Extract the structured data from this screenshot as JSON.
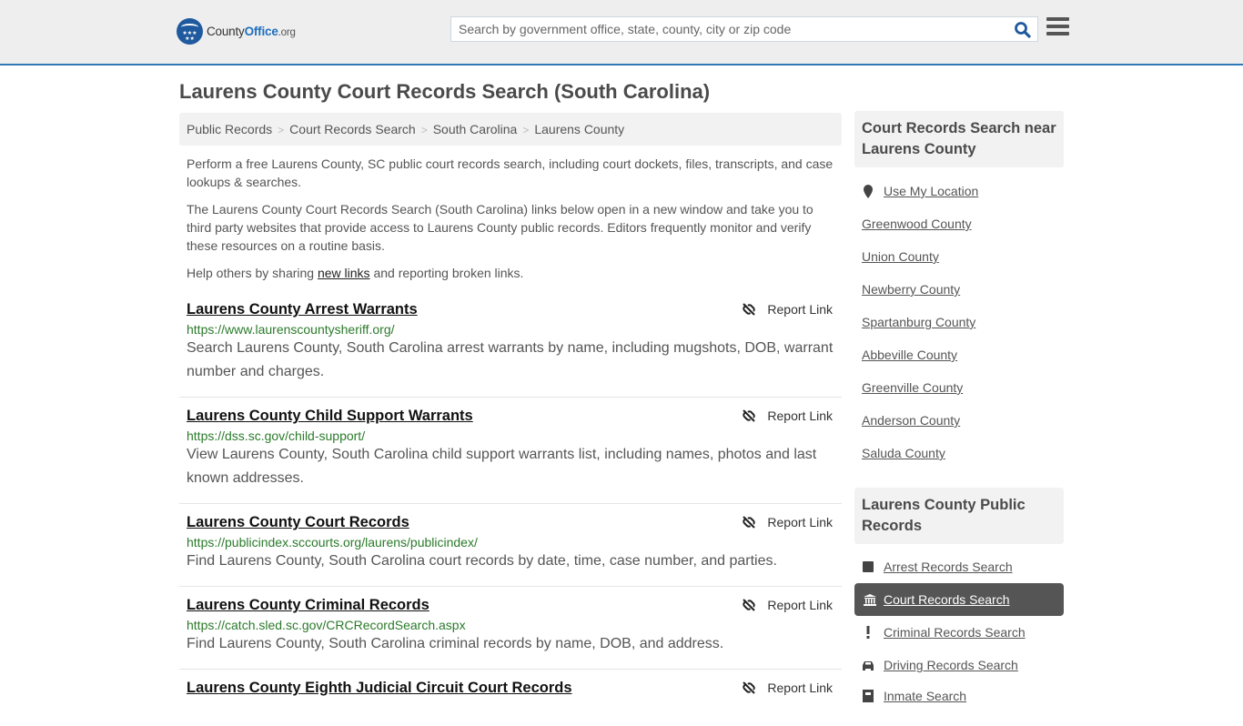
{
  "header": {
    "logo": {
      "name": "County",
      "accent": "Office",
      "tld": ".org"
    },
    "search": {
      "placeholder": "Search by government office, state, county, city or zip code",
      "value": ""
    }
  },
  "page_title": "Laurens County Court Records Search (South Carolina)",
  "breadcrumb": [
    "Public Records",
    "Court Records Search",
    "South Carolina",
    "Laurens County"
  ],
  "intro": {
    "p1": "Perform a free Laurens County, SC public court records search, including court dockets, files, transcripts, and case lookups & searches.",
    "p2": "The Laurens County Court Records Search (South Carolina) links below open in a new window and take you to third party websites that provide access to Laurens County public records. Editors frequently monitor and verify these resources on a routine basis.",
    "p3_before": "Help others by sharing ",
    "p3_link": "new links",
    "p3_after": " and reporting broken links."
  },
  "report_label": "Report Link",
  "listings": [
    {
      "title": "Laurens County Arrest Warrants",
      "url": "https://www.laurenscountysheriff.org/",
      "desc": "Search Laurens County, South Carolina arrest warrants by name, including mugshots, DOB, warrant number and charges."
    },
    {
      "title": "Laurens County Child Support Warrants",
      "url": "https://dss.sc.gov/child-support/",
      "desc": "View Laurens County, South Carolina child support warrants list, including names, photos and last known addresses."
    },
    {
      "title": "Laurens County Court Records",
      "url": "https://publicindex.sccourts.org/laurens/publicindex/",
      "desc": "Find Laurens County, South Carolina court records by date, time, case number, and parties."
    },
    {
      "title": "Laurens County Criminal Records",
      "url": "https://catch.sled.sc.gov/CRCRecordSearch.aspx",
      "desc": "Find Laurens County, South Carolina criminal records by name, DOB, and address."
    },
    {
      "title": "Laurens County Eighth Judicial Circuit Court Records",
      "url": "",
      "desc": ""
    }
  ],
  "sidebar": {
    "nearby_title": "Court Records Search near Laurens County",
    "use_location": "Use My Location",
    "nearby": [
      "Greenwood County",
      "Union County",
      "Newberry County",
      "Spartanburg County",
      "Abbeville County",
      "Greenville County",
      "Anderson County",
      "Saluda County"
    ],
    "public_title": "Laurens County Public Records",
    "public_records": [
      {
        "label": "Arrest Records Search",
        "icon": "square-icon",
        "active": false
      },
      {
        "label": "Court Records Search",
        "icon": "courthouse-icon",
        "active": true
      },
      {
        "label": "Criminal Records Search",
        "icon": "exclamation-icon",
        "active": false
      },
      {
        "label": "Driving Records Search",
        "icon": "car-icon",
        "active": false
      },
      {
        "label": "Inmate Search",
        "icon": "inmate-icon",
        "active": false
      }
    ]
  },
  "colors": {
    "brand_blue": "#1f6fbf",
    "header_border": "#3178b5",
    "url_green": "#2a7a2a",
    "active_bg": "#555555"
  }
}
